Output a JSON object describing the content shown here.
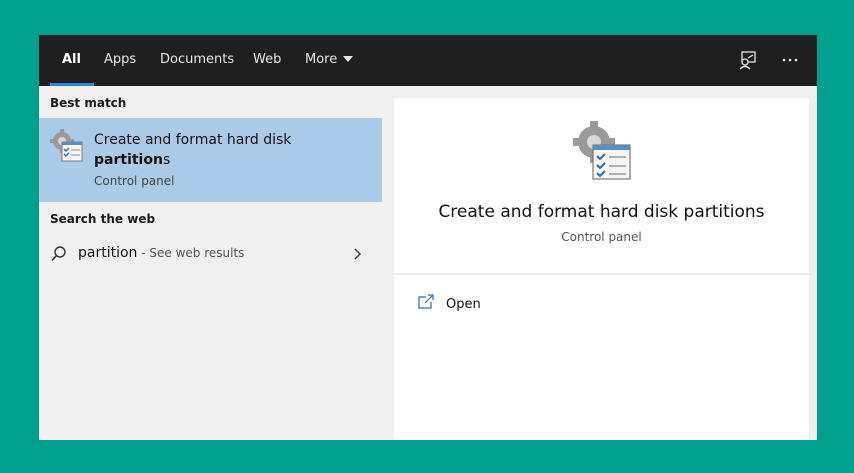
{
  "tabs": [
    {
      "label": "All",
      "active": true
    },
    {
      "label": "Apps"
    },
    {
      "label": "Documents"
    },
    {
      "label": "Web"
    },
    {
      "label": "More"
    }
  ],
  "icons": {
    "feedback": "feedback-icon",
    "more": "ellipsis-icon",
    "result": "control-panel-gear-checklist-icon",
    "search": "search-icon",
    "arrow": "chevron-right-icon",
    "open": "open-icon"
  },
  "left": {
    "best_match_heading": "Best match",
    "best_match": {
      "title_prefix": "Create and format hard disk",
      "title_bold": "partition",
      "title_suffix": "s",
      "subtitle": "Control panel"
    },
    "search_web_heading": "Search the web",
    "web_query": "partition",
    "web_hint": " - See web results"
  },
  "right": {
    "title": "Create and format hard disk partitions",
    "subtitle": "Control panel",
    "actions": [
      {
        "label": "Open"
      }
    ]
  },
  "colors": {
    "background": "#00a08c",
    "topbar": "#1f1f1f",
    "accent": "#2b88d8",
    "selected": "#a9cbe8"
  }
}
